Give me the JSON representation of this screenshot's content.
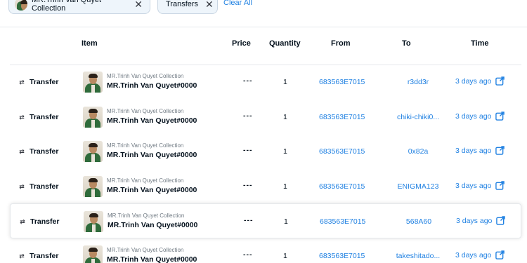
{
  "filters": {
    "chips": [
      {
        "label": "MR.Trinh Van Quyet Collection"
      },
      {
        "label": "Transfers"
      }
    ],
    "clear_all": "Clear All"
  },
  "columns": {
    "item": "Item",
    "price": "Price",
    "quantity": "Quantity",
    "from": "From",
    "to": "To",
    "time": "Time"
  },
  "rows": [
    {
      "event": "Transfer",
      "collection": "MR.Trinh Van Quyet Collection",
      "item": "MR.Trinh Van Quyet#0000",
      "price": "---",
      "quantity": "1",
      "from": "683563E7015",
      "to": "r3dd3r",
      "time": "3 days ago"
    },
    {
      "event": "Transfer",
      "collection": "MR.Trinh Van Quyet Collection",
      "item": "MR.Trinh Van Quyet#0000",
      "price": "---",
      "quantity": "1",
      "from": "683563E7015",
      "to": "chiki-chiki0...",
      "time": "3 days ago"
    },
    {
      "event": "Transfer",
      "collection": "MR.Trinh Van Quyet Collection",
      "item": "MR.Trinh Van Quyet#0000",
      "price": "---",
      "quantity": "1",
      "from": "683563E7015",
      "to": "0x82a",
      "time": "3 days ago"
    },
    {
      "event": "Transfer",
      "collection": "MR.Trinh Van Quyet Collection",
      "item": "MR.Trinh Van Quyet#0000",
      "price": "---",
      "quantity": "1",
      "from": "683563E7015",
      "to": "ENIGMA123",
      "time": "3 days ago"
    },
    {
      "event": "Transfer",
      "collection": "MR.Trinh Van Quyet Collection",
      "item": "MR.Trinh Van Quyet#0000",
      "price": "---",
      "quantity": "1",
      "from": "683563E7015",
      "to": "568A60",
      "time": "3 days ago"
    },
    {
      "event": "Transfer",
      "collection": "MR.Trinh Van Quyet Collection",
      "item": "MR.Trinh Van Quyet#0000",
      "price": "---",
      "quantity": "1",
      "from": "683563E7015",
      "to": "takeshitado...",
      "time": "3 days ago"
    }
  ],
  "icons": {
    "event": "transfer-arrows-icon",
    "time_link": "external-link-icon",
    "chip_close": "close-icon"
  },
  "colors": {
    "link": "#2081e2",
    "text": "#04111d",
    "muted": "#707a83",
    "chip_bg": "#eef5fb"
  }
}
